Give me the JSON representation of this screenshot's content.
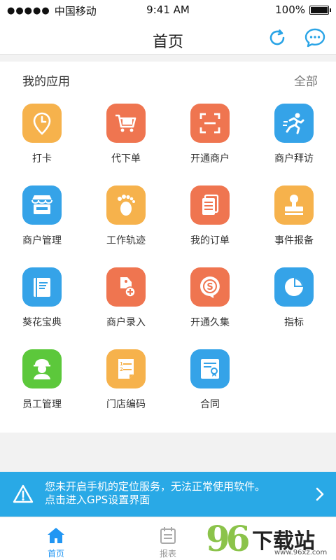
{
  "status_bar": {
    "signal_dots": "●●●●●",
    "carrier": "中国移动",
    "time": "9:41 AM",
    "battery": "100%",
    "battery_level": 1.0
  },
  "nav": {
    "title": "首页",
    "refresh_icon": "refresh-icon",
    "message_icon": "chat-bubble-icon",
    "accent": "#2aa4e6"
  },
  "apps": {
    "section_title": "我的应用",
    "all_link": "全部",
    "items": [
      {
        "label": "打卡",
        "icon": "clock-pin-icon",
        "color": "#f6b24c"
      },
      {
        "label": "代下单",
        "icon": "cart-icon",
        "color": "#ef7550"
      },
      {
        "label": "开通商户",
        "icon": "scan-icon",
        "color": "#ef7550"
      },
      {
        "label": "商户拜访",
        "icon": "runner-icon",
        "color": "#35a3e8"
      },
      {
        "label": "商户管理",
        "icon": "storefront-icon",
        "color": "#35a3e8"
      },
      {
        "label": "工作轨迹",
        "icon": "footprint-icon",
        "color": "#f6b24c"
      },
      {
        "label": "我的订单",
        "icon": "document-icon",
        "color": "#ef7550"
      },
      {
        "label": "事件报备",
        "icon": "stamp-icon",
        "color": "#f6b24c"
      },
      {
        "label": "葵花宝典",
        "icon": "book-icon",
        "color": "#35a3e8"
      },
      {
        "label": "商户录入",
        "icon": "tag-add-icon",
        "color": "#ef7550"
      },
      {
        "label": "开通久集",
        "icon": "s-bubble-icon",
        "color": "#ef7550"
      },
      {
        "label": "指标",
        "icon": "pie-chart-icon",
        "color": "#35a3e8"
      },
      {
        "label": "员工管理",
        "icon": "staff-icon",
        "color": "#5cc83b"
      },
      {
        "label": "门店编码",
        "icon": "numbered-list-icon",
        "color": "#f6b24c"
      },
      {
        "label": "合同",
        "icon": "certificate-icon",
        "color": "#35a3e8"
      }
    ]
  },
  "gps_banner": {
    "line1": "您未开启手机的定位服务，无法正常使用软件。",
    "line2": "点击进入GPS设置界面",
    "color": "#29a9e6"
  },
  "tabs": [
    {
      "label": "首页",
      "icon": "home-icon",
      "active": true
    },
    {
      "label": "报表",
      "icon": "calendar-report-icon",
      "active": false
    }
  ],
  "watermark": {
    "number": "96",
    "text": "下载站",
    "url": "www.96xz.com"
  }
}
